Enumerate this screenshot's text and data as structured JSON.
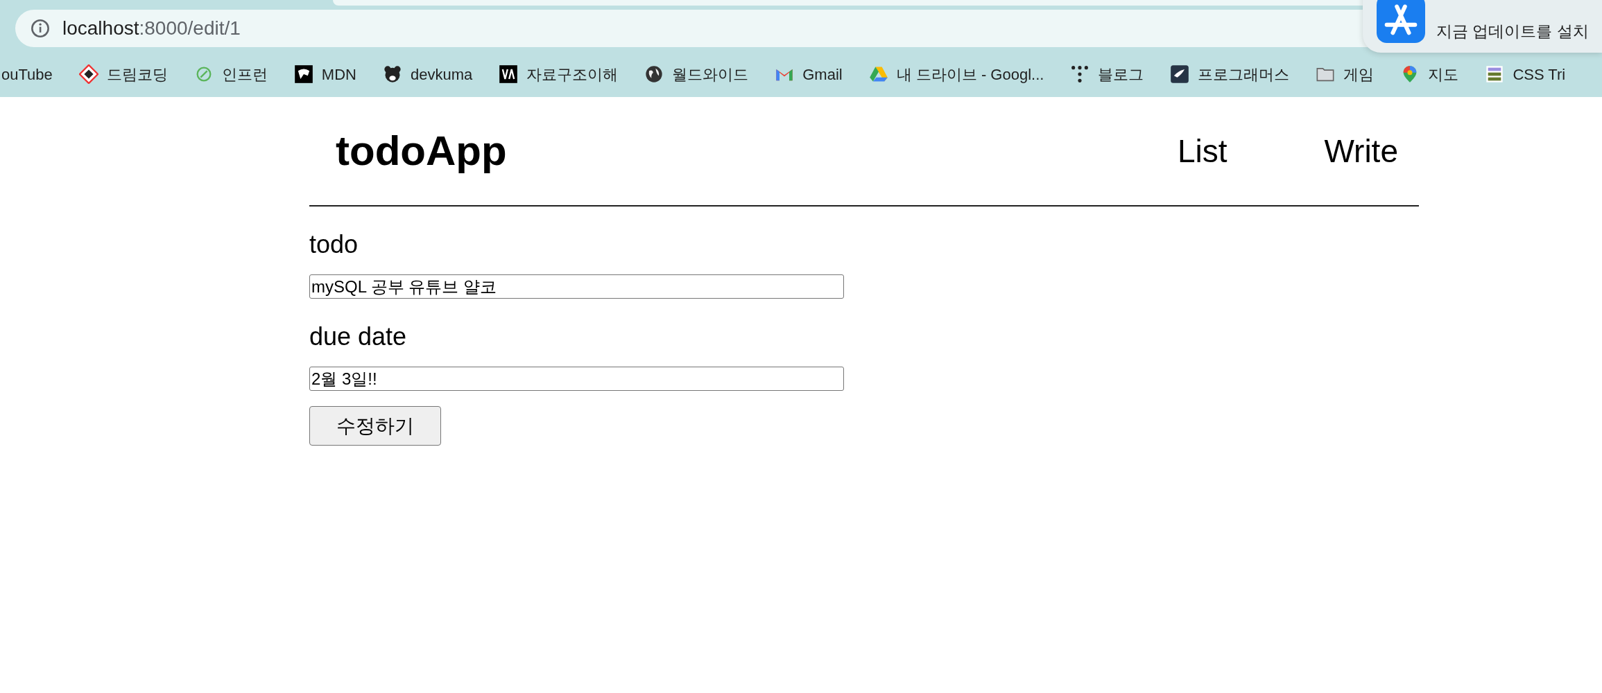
{
  "browser": {
    "address": {
      "host": "localhost",
      "path": ":8000/edit/1"
    },
    "bookmarks": [
      {
        "label": "ouTube"
      },
      {
        "label": "드림코딩"
      },
      {
        "label": "인프런"
      },
      {
        "label": "MDN"
      },
      {
        "label": "devkuma"
      },
      {
        "label": "자료구조이해"
      },
      {
        "label": "월드와이드"
      },
      {
        "label": "Gmail"
      },
      {
        "label": "내 드라이브 - Googl..."
      },
      {
        "label": "블로그"
      },
      {
        "label": "프로그래머스"
      },
      {
        "label": "게임"
      },
      {
        "label": "지도"
      },
      {
        "label": "CSS Tri"
      }
    ],
    "notification": {
      "message": "지금 업데이트를 설치"
    }
  },
  "page": {
    "brand": "todoApp",
    "nav": [
      "List",
      "Write"
    ],
    "fields": [
      {
        "label": "todo",
        "value": "mySQL 공부 유튜브 얄코"
      },
      {
        "label": "due date",
        "value": "2월 3일!!"
      }
    ],
    "submit": "수정하기"
  }
}
